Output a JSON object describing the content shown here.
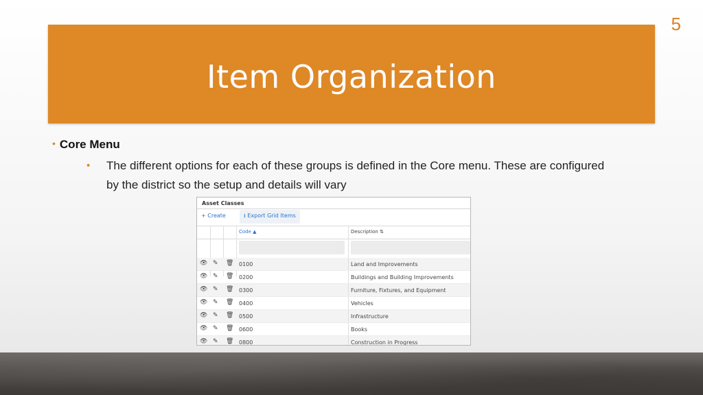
{
  "slide": {
    "number": "5",
    "title": "Item Organization",
    "bullet1": "Core Menu",
    "bullet2": "The different options for each of these groups is defined in the Core menu. These are configured by the district so the setup and details will vary"
  },
  "panel": {
    "title": "Asset Classes",
    "create_label": "+ Create",
    "export_label": "Export Grid Items",
    "columns": {
      "code": "Code ▲",
      "description": "Description ⇅"
    },
    "rows": [
      {
        "code": "0100",
        "description": "Land and Improvements"
      },
      {
        "code": "0200",
        "description": "Buildings and Building Improvements"
      },
      {
        "code": "0300",
        "description": "Furniture, Fixtures, and Equipment"
      },
      {
        "code": "0400",
        "description": "Vehicles"
      },
      {
        "code": "0500",
        "description": "Infrastructure"
      },
      {
        "code": "0600",
        "description": "Books"
      },
      {
        "code": "0800",
        "description": "Construction in Progress"
      }
    ],
    "icons": {
      "view": "👁",
      "edit": "✎",
      "delete": "🗑",
      "download": "⭳"
    }
  },
  "colors": {
    "accent": "#de8826",
    "link": "#2b73c7"
  }
}
